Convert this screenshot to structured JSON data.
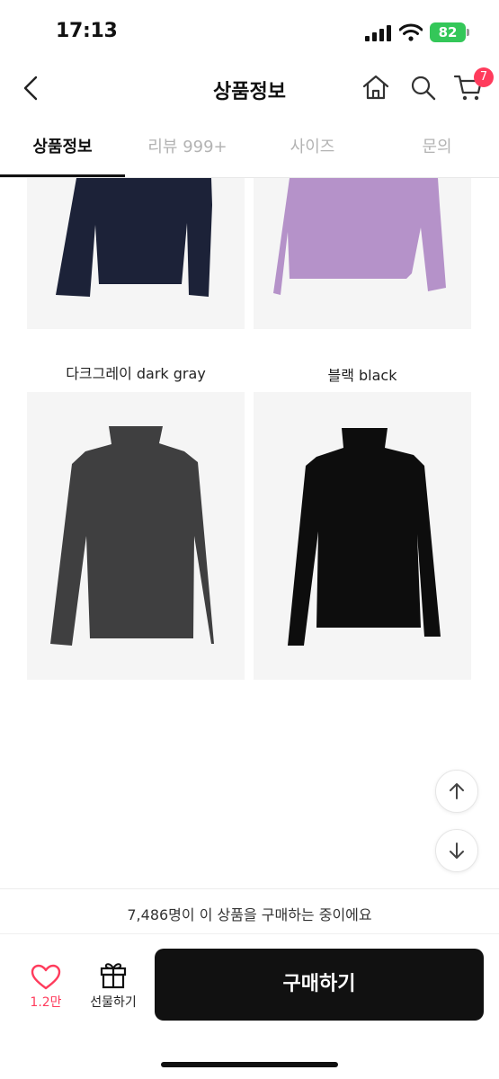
{
  "status_bar": {
    "time": "17:13",
    "battery": "82"
  },
  "header": {
    "title": "상품정보",
    "cart_count": "7"
  },
  "tabs": [
    {
      "label": "상품정보",
      "active": true
    },
    {
      "label": "리뷰 999+",
      "active": false
    },
    {
      "label": "사이즈",
      "active": false
    },
    {
      "label": "문의",
      "active": false
    }
  ],
  "products": [
    {
      "color_name": "",
      "swatch": "#1c2238"
    },
    {
      "color_name": "",
      "swatch": "#b592c9"
    },
    {
      "color_name": "다크그레이 dark gray",
      "swatch": "#3f3f40"
    },
    {
      "color_name": "블랙 black",
      "swatch": "#0d0d0d"
    }
  ],
  "bottom": {
    "buyers_notice": "7,486명이 이 상품을 구매하는 중이에요",
    "like_count": "1.2만",
    "gift_label": "선물하기",
    "buy_label": "구매하기"
  },
  "colors": {
    "accent": "#ff3b5c",
    "buy_button": "#111111",
    "battery": "#34c759"
  },
  "icons": [
    "back-icon",
    "home-icon",
    "search-icon",
    "cart-icon",
    "heart-icon",
    "gift-icon",
    "arrow-up-icon",
    "arrow-down-icon"
  ]
}
